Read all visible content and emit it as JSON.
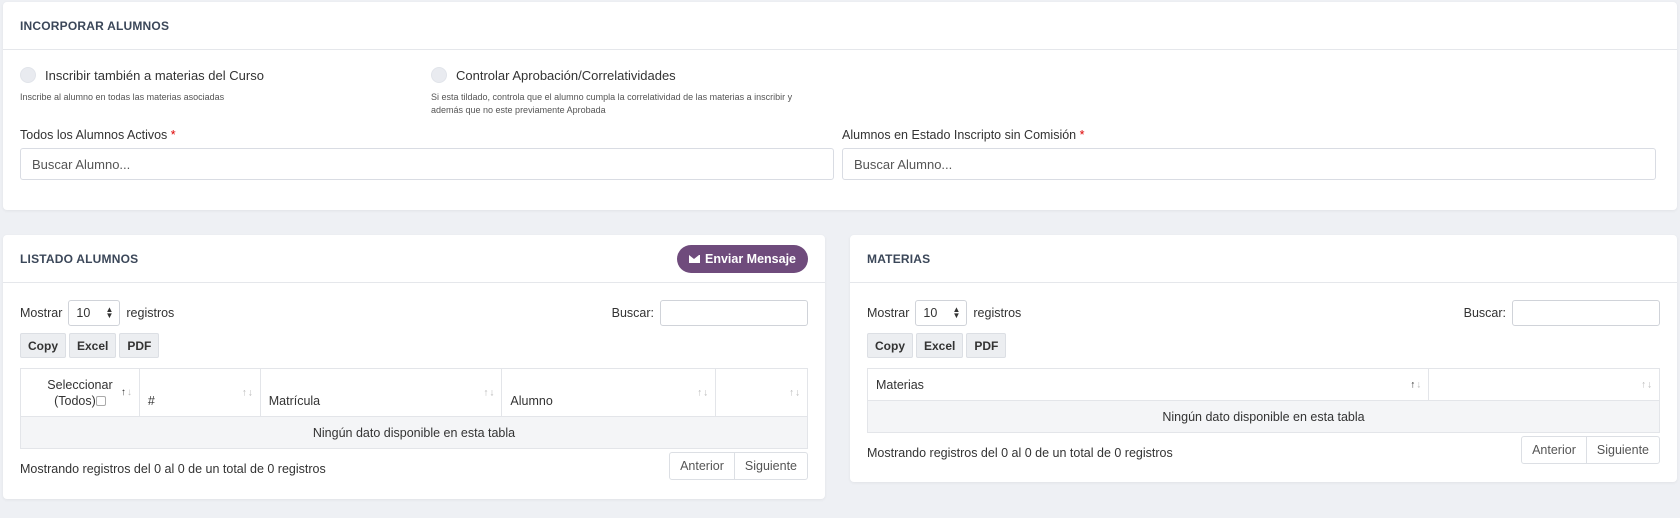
{
  "incorporar": {
    "title": "INCORPORAR ALUMNOS",
    "option1": {
      "label": "Inscribir también a materias del Curso",
      "help": "Inscribe al alumno en todas las materias asociadas"
    },
    "option2": {
      "label": "Controlar Aprobación/Correlatividades",
      "help_line1": "Si esta tildado, controla que el alumno cumpla la correlatividad de las materias a inscribir y",
      "help_line2": "además que no este previamente Aprobada"
    },
    "field1": {
      "label": "Todos los Alumnos Activos",
      "required": "*",
      "placeholder": "Buscar Alumno..."
    },
    "field2": {
      "label": "Alumnos en Estado Inscripto sin Comisión",
      "required": "*",
      "placeholder": "Buscar Alumno..."
    }
  },
  "listado": {
    "title": "LISTADO ALUMNOS",
    "send_button": "Enviar Mensaje",
    "show_label": "Mostrar",
    "page_len": "10",
    "records_label": "registros",
    "search_label": "Buscar:",
    "buttons": [
      "Copy",
      "Excel",
      "PDF"
    ],
    "columns": [
      "Seleccionar",
      "(Todos)",
      "#",
      "Matrícula",
      "Alumno",
      ""
    ],
    "empty": "Ningún dato disponible en esta tabla",
    "info": "Mostrando registros del 0 al 0 de un total de 0 registros",
    "prev": "Anterior",
    "next": "Siguiente"
  },
  "materias": {
    "title": "MATERIAS",
    "show_label": "Mostrar",
    "page_len": "10",
    "records_label": "registros",
    "search_label": "Buscar:",
    "buttons": [
      "Copy",
      "Excel",
      "PDF"
    ],
    "columns": [
      "Materias",
      ""
    ],
    "empty": "Ningún dato disponible en esta tabla",
    "info": "Mostrando registros del 0 al 0 de un total de 0 registros",
    "prev": "Anterior",
    "next": "Siguiente"
  },
  "colors": {
    "accent": "#6f4b7c",
    "required": "#dd0000",
    "title": "#3b4759"
  },
  "icons": {
    "send": "envelope-icon"
  }
}
